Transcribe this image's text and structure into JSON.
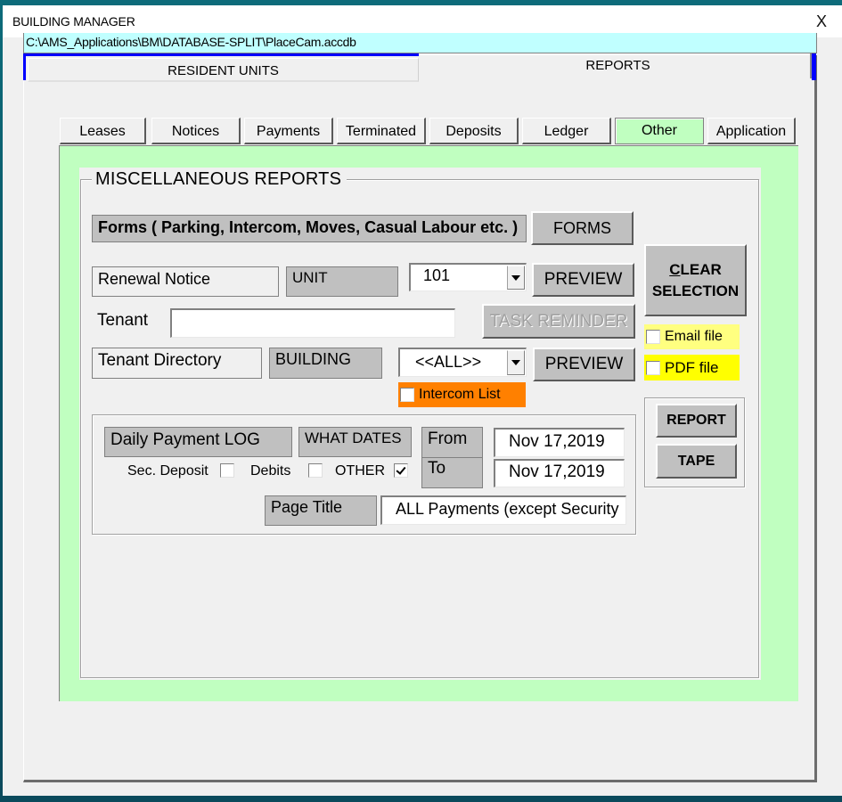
{
  "window": {
    "title": "BUILDING MANAGER",
    "close_label": "X",
    "db_path": "C:\\AMS_Applications\\BM\\DATABASE-SPLIT\\PlaceCam.accdb"
  },
  "main_tabs": [
    {
      "label": "RESIDENT UNITS",
      "active": false
    },
    {
      "label": "REPORTS",
      "active": true
    }
  ],
  "sub_tabs": [
    {
      "label": "Leases",
      "active": false
    },
    {
      "label": "Notices",
      "active": false
    },
    {
      "label": "Payments",
      "active": false
    },
    {
      "label": "Terminated",
      "active": false
    },
    {
      "label": "Deposits",
      "active": false
    },
    {
      "label": "Ledger",
      "active": false
    },
    {
      "label": "Other",
      "active": true
    },
    {
      "label": "Application",
      "active": false
    }
  ],
  "colors": {
    "active_panel": "#c0ffc0",
    "path_bar": "#c0ffff",
    "tab_accent": "#0000ff",
    "intercom_bg": "#ff8000",
    "email_bg": "#ffff80",
    "pdf_bg": "#ffff00"
  },
  "misc": {
    "group_title": "MISCELLANEOUS REPORTS",
    "forms_label": "Forms ( Parking, Intercom, Moves, Casual Labour etc. )",
    "forms_button": "FORMS",
    "renewal_label": "Renewal Notice",
    "unit_label": "UNIT",
    "unit_value": "101",
    "renewal_preview": "PREVIEW",
    "tenant_label": "Tenant",
    "tenant_value": "",
    "task_reminder": "TASK REMINDER",
    "directory_label": "Tenant Directory",
    "building_label": "BUILDING",
    "building_value": "<<ALL>>",
    "directory_preview": "PREVIEW",
    "intercom_label": "Intercom List",
    "intercom_checked": false,
    "clear_line1": "CLEAR",
    "clear_line1_rest": "LEAR",
    "clear_hotkey": "C",
    "clear_line2": "SELECTION",
    "email_label": "Email file",
    "email_checked": false,
    "pdf_label": "PDF file",
    "pdf_checked": false
  },
  "payment_log": {
    "title": "Daily Payment LOG",
    "what_dates": "WHAT DATES",
    "from_label": "From",
    "from_value": "Nov 17,2019",
    "to_label": "To",
    "to_value": "Nov 17,2019",
    "sec_deposit_label": "Sec. Deposit",
    "sec_deposit_checked": false,
    "debits_label": "Debits",
    "debits_checked": false,
    "other_label": "OTHER",
    "other_checked": true,
    "page_title_label": "Page Title",
    "page_title_value": "ALL Payments (except Security"
  },
  "actions": {
    "report_button": "REPORT",
    "tape_button": "TAPE"
  }
}
